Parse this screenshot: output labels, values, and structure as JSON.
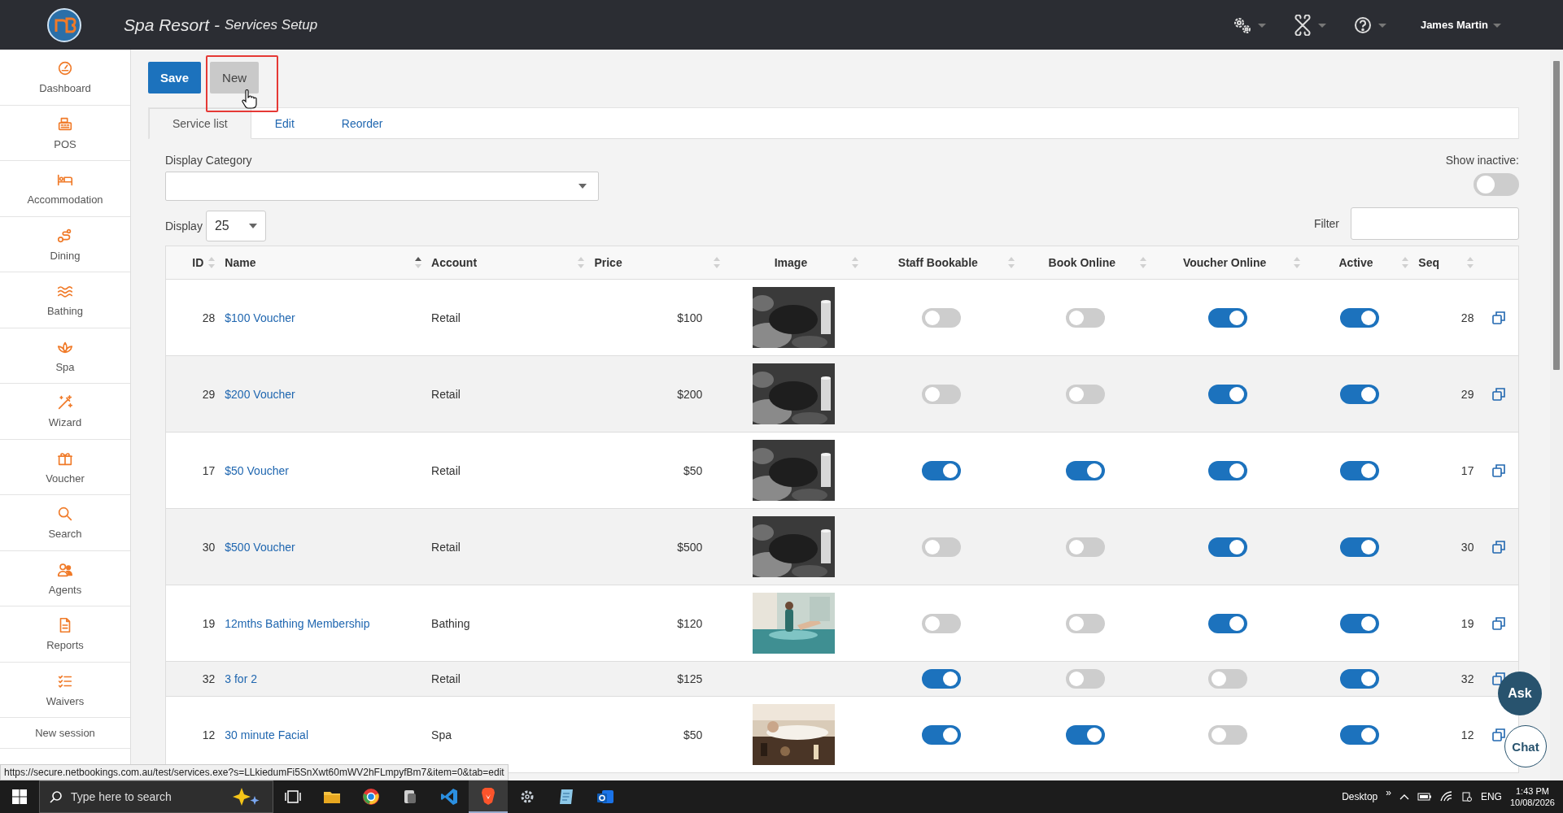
{
  "header": {
    "title": "Spa Resort -",
    "subtitle": "Services Setup",
    "user": "James Martin"
  },
  "sidebar": {
    "items": [
      {
        "label": "Dashboard"
      },
      {
        "label": "POS"
      },
      {
        "label": "Accommodation"
      },
      {
        "label": "Dining"
      },
      {
        "label": "Bathing"
      },
      {
        "label": "Spa"
      },
      {
        "label": "Wizard"
      },
      {
        "label": "Voucher"
      },
      {
        "label": "Search"
      },
      {
        "label": "Agents"
      },
      {
        "label": "Reports"
      },
      {
        "label": "Waivers"
      }
    ],
    "links": [
      "New session"
    ]
  },
  "toolbar": {
    "buttons": [
      {
        "label": "Save",
        "kind": "primary",
        "highlighted": false
      },
      {
        "label": "New",
        "kind": "secondary",
        "highlighted": true
      }
    ]
  },
  "tabs": [
    {
      "label": "Service list",
      "selected": true
    },
    {
      "label": "Edit",
      "selected": false
    },
    {
      "label": "Reorder",
      "selected": false
    }
  ],
  "filters": {
    "category_label": "Display Category",
    "show_inactive": {
      "label": "Show inactive:",
      "on": false
    },
    "display_label": "Display",
    "page_size": "25",
    "filter_label": "Filter"
  },
  "table": {
    "columns": [
      {
        "label": "ID",
        "sorted": false
      },
      {
        "label": "Name",
        "sorted": true
      },
      {
        "label": "Account",
        "sorted": false
      },
      {
        "label": "Price",
        "sorted": false
      },
      {
        "label": "Image",
        "sorted": false
      },
      {
        "label": "Staff Bookable",
        "sorted": false
      },
      {
        "label": "Book Online",
        "sorted": false
      },
      {
        "label": "Voucher Online",
        "sorted": false
      },
      {
        "label": "Active",
        "sorted": false
      },
      {
        "label": "Seq",
        "sorted": false
      }
    ],
    "rows": [
      {
        "id": "28",
        "name": "$100 Voucher",
        "account": "Retail",
        "price": "$100",
        "staff_bookable": false,
        "book_online": false,
        "voucher_online": true,
        "active": true,
        "seq": "28"
      },
      {
        "id": "29",
        "name": "$200 Voucher",
        "account": "Retail",
        "price": "$200",
        "staff_bookable": false,
        "book_online": false,
        "voucher_online": true,
        "active": true,
        "seq": "29"
      },
      {
        "id": "17",
        "name": "$50 Voucher",
        "account": "Retail",
        "price": "$50",
        "staff_bookable": true,
        "book_online": true,
        "voucher_online": true,
        "active": true,
        "seq": "17"
      },
      {
        "id": "30",
        "name": "$500 Voucher",
        "account": "Retail",
        "price": "$500",
        "staff_bookable": false,
        "book_online": false,
        "voucher_online": true,
        "active": true,
        "seq": "30"
      },
      {
        "id": "19",
        "name": "12mths Bathing Membership",
        "account": "Bathing",
        "price": "$120",
        "staff_bookable": false,
        "book_online": false,
        "voucher_online": true,
        "active": true,
        "seq": "19"
      },
      {
        "id": "32",
        "name": "3 for 2",
        "account": "Retail",
        "price": "$125",
        "staff_bookable": true,
        "book_online": false,
        "voucher_online": false,
        "active": true,
        "seq": "32"
      },
      {
        "id": "12",
        "name": "30 minute Facial",
        "account": "Spa",
        "price": "$50",
        "staff_bookable": true,
        "book_online": true,
        "voucher_online": false,
        "active": true,
        "seq": "12"
      }
    ]
  },
  "status_url": "https://secure.netbookings.com.au/test/services.exe?s=LLkiedumFi5SnXwt60mWV2hFLmpyfBm7&item=0&tab=edit",
  "chat": [
    "Ask",
    "Chat"
  ],
  "taskbar": {
    "search_placeholder": "Type here to search",
    "desktop": "Desktop",
    "chevron": "»",
    "language": "ENG",
    "time": "1:43 PM",
    "date": "10/08/2026"
  }
}
